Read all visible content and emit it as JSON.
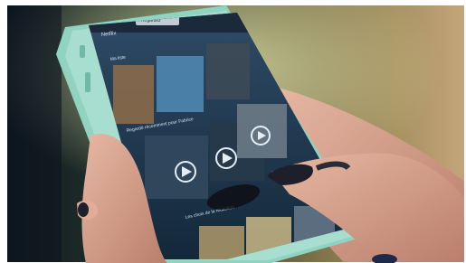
{
  "photo": {
    "subject": "hands holding a smartphone showing a video streaming app",
    "phone_case_color": "#8fd3c0",
    "screen_tint": "#1f3a52",
    "nail_color": "#1d1f2a"
  },
  "screen": {
    "app_name": "Netflix",
    "badge": "Regardez",
    "row1_title": "Ma liste",
    "row2_title": "Regardé récemment pour Fabrice",
    "row3_title": "Les choix de la rédaction"
  }
}
